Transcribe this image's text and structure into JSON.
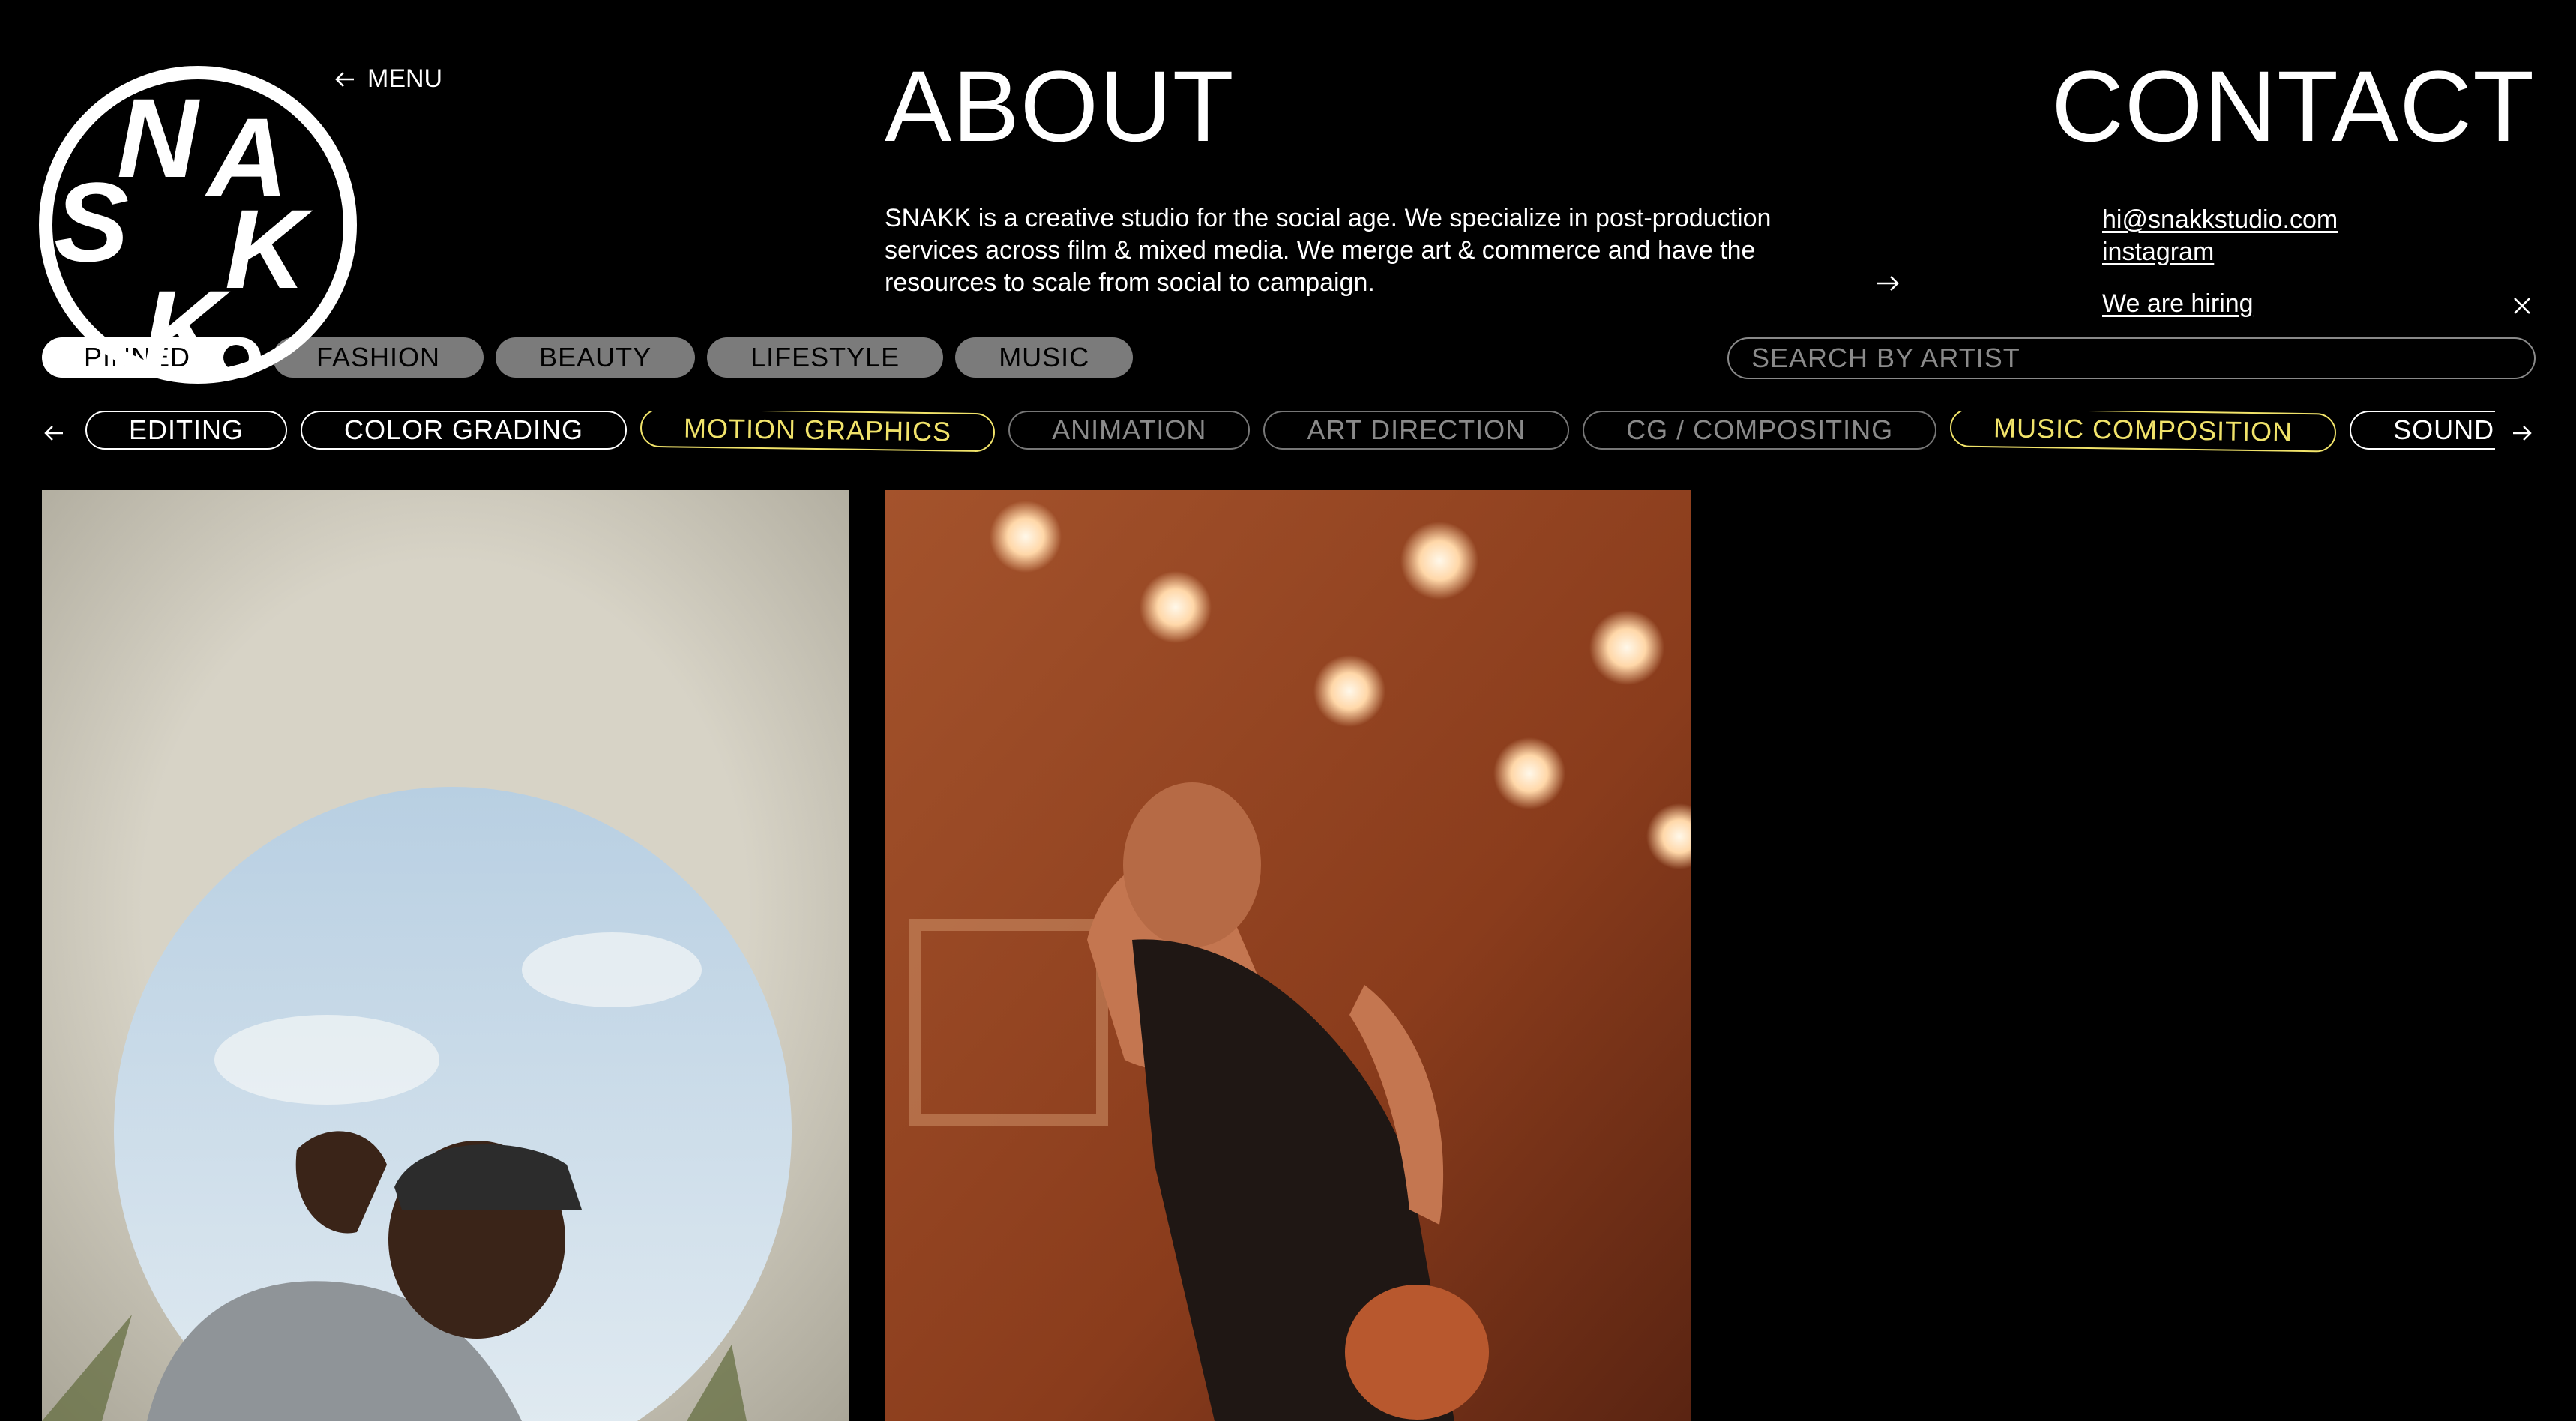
{
  "logo": {
    "text": "SNAKK",
    "letters": [
      "N",
      "A",
      "S",
      "K",
      "K"
    ]
  },
  "nav": {
    "menu_label": "MENU"
  },
  "about": {
    "title": "ABOUT",
    "text": "SNAKK is a creative studio for the social age. We specialize in post-production services across film & mixed media. We merge art & commerce and have the resources to scale from social to campaign."
  },
  "contact": {
    "title": "CONTACT",
    "email": "hi@snakkstudio.com",
    "instagram": "instagram",
    "hiring": "We are hiring"
  },
  "filters": {
    "pinned": "PINNED",
    "categories": [
      "FASHION",
      "BEAUTY",
      "LIFESTYLE",
      "MUSIC"
    ]
  },
  "search": {
    "placeholder": "SEARCH BY ARTIST"
  },
  "services": [
    {
      "label": "EDITING",
      "state": "default"
    },
    {
      "label": "COLOR GRADING",
      "state": "default"
    },
    {
      "label": "MOTION GRAPHICS",
      "state": "active"
    },
    {
      "label": "ANIMATION",
      "state": "dim"
    },
    {
      "label": "ART DIRECTION",
      "state": "dim"
    },
    {
      "label": "CG / COMPOSITING",
      "state": "dim"
    },
    {
      "label": "MUSIC COMPOSITION",
      "state": "active"
    },
    {
      "label": "SOUND DESIGN",
      "state": "default"
    }
  ],
  "colors": {
    "background": "#000000",
    "accent": "#f1e36a",
    "pill_grey": "#7b7b7b"
  },
  "media": [
    {
      "name": "man-looking-into-hole",
      "type": "video-thumbnail"
    },
    {
      "name": "basketball-player-stage-lights",
      "type": "video-thumbnail"
    }
  ]
}
